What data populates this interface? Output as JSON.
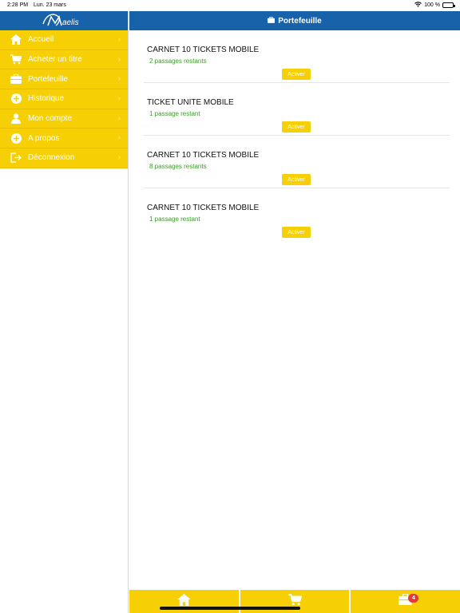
{
  "status_bar": {
    "time": "2:28 PM",
    "date": "Lun. 23 mars",
    "battery": "100 %"
  },
  "app": {
    "logo_text": "aelis",
    "brand_color": "#1762a9",
    "accent_color": "#f7cf05"
  },
  "sidebar": {
    "items": [
      {
        "label": "Accueil",
        "icon": "home-icon"
      },
      {
        "label": "Acheter un titre",
        "icon": "cart-icon"
      },
      {
        "label": "Portefeuille",
        "icon": "wallet-icon"
      },
      {
        "label": "Historique",
        "icon": "plus-circle-icon"
      },
      {
        "label": "Mon compte",
        "icon": "user-icon"
      },
      {
        "label": "A propos",
        "icon": "plus-circle-icon"
      },
      {
        "label": "Déconnexion",
        "icon": "logout-icon"
      }
    ]
  },
  "header": {
    "title": "Portefeuille"
  },
  "tickets": [
    {
      "title": "CARNET 10 TICKETS MOBILE",
      "remaining": "2 passages restants",
      "action": "Activer"
    },
    {
      "title": "TICKET UNITE MOBILE",
      "remaining": "1 passage restant",
      "action": "Activer"
    },
    {
      "title": "CARNET 10 TICKETS MOBILE",
      "remaining": "8 passages restants",
      "action": "Activer"
    },
    {
      "title": "CARNET 10 TICKETS MOBILE",
      "remaining": "1 passage restant",
      "action": "Activer"
    }
  ],
  "tabbar": {
    "badge_count": "4"
  }
}
